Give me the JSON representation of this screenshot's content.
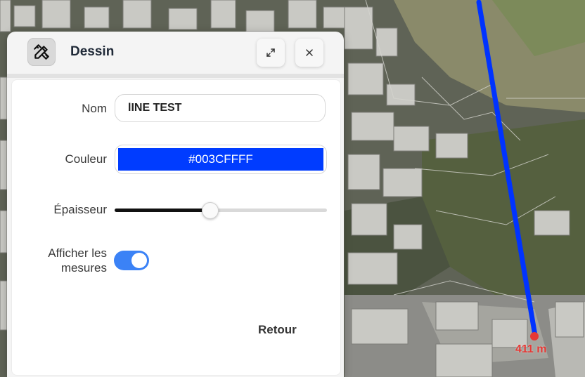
{
  "panel": {
    "title": "Dessin",
    "app_icon": "pencil-ruler-icon",
    "expand_icon": "expand-icon",
    "close_icon": "close-icon"
  },
  "form": {
    "name_label": "Nom",
    "name_value": "lINE TEST",
    "color_label": "Couleur",
    "color_value": "#003CFFFF",
    "color_hex": "#003CFF",
    "thickness_label": "Épaisseur",
    "thickness_fraction": 0.45,
    "show_measures_label_line1": "Afficher les",
    "show_measures_label_line2": "mesures",
    "show_measures_enabled": true,
    "back_label": "Retour"
  },
  "map": {
    "measure_label": "411 m",
    "line_color": "#0033FF",
    "marker_color": "#E53935"
  }
}
